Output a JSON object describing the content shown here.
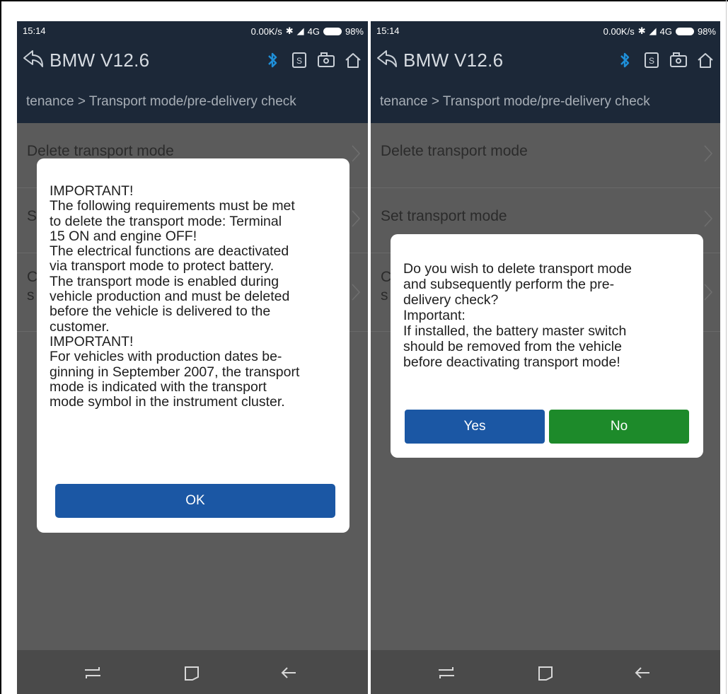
{
  "left": {
    "status": {
      "time": "15:14",
      "network": "0.00K/s",
      "signal": "4G",
      "battery": "98%"
    },
    "app_title": "BMW V12.6",
    "breadcrumb": "tenance > Transport mode/pre-delivery check",
    "list": [
      {
        "label": "Delete transport mode"
      },
      {
        "label": "S"
      },
      {
        "label": "C"
      }
    ],
    "list_extra": "s",
    "dialog": {
      "lines": [
        "IMPORTANT!",
        "The following requirements must be met",
        "to delete the transport mode: Terminal",
        "15 ON and engine OFF!",
        "The electrical functions are deactivated",
        "via transport mode to protect battery.",
        "The transport mode is enabled during",
        "vehicle production and must be deleted",
        "before the vehicle is delivered to the",
        "customer.",
        "IMPORTANT!",
        "For vehicles with production dates be-",
        "ginning in September 2007, the transport",
        "mode is indicated with the transport",
        "mode symbol in the instrument cluster."
      ],
      "ok_label": "OK"
    }
  },
  "right": {
    "status": {
      "time": "15:14",
      "network": "0.00K/s",
      "signal": "4G",
      "battery": "98%"
    },
    "app_title": "BMW V12.6",
    "breadcrumb": "tenance > Transport mode/pre-delivery check",
    "list": [
      {
        "label": "Delete transport mode"
      },
      {
        "label": "Set transport mode"
      },
      {
        "label": "C"
      }
    ],
    "list_extra": "s",
    "dialog": {
      "lines": [
        "Do you wish to delete transport mode",
        "and subsequently perform the pre-",
        "delivery check?",
        "Important:",
        "If installed, the battery master switch",
        "should be removed from the vehicle",
        "before deactivating transport mode!"
      ],
      "yes_label": "Yes",
      "no_label": "No"
    }
  },
  "colors": {
    "header_bg": "#1c2838",
    "overlay_bg": "#5b5b5b",
    "primary_button": "#1b57a4",
    "no_button": "#1d8a2a",
    "bluetooth_icon": "#1f8fd8"
  },
  "icons": [
    "back-icon",
    "bluetooth-icon",
    "report-icon",
    "camera-icon",
    "home-icon",
    "recent-apps-icon",
    "overview-icon",
    "back-nav-icon"
  ]
}
